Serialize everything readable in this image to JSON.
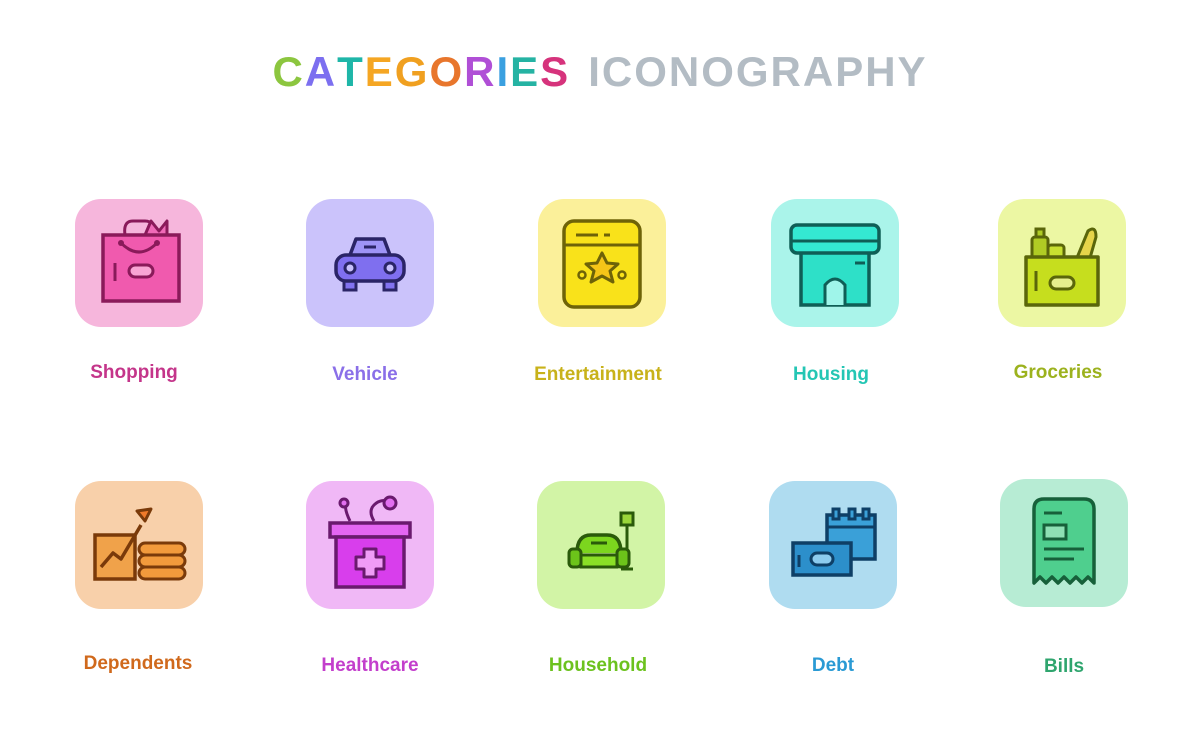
{
  "title": {
    "word1": [
      "C",
      "A",
      "T",
      "E",
      "G",
      "O",
      "R",
      "I",
      "E",
      "S"
    ],
    "word1_colors": [
      "#8cc63f",
      "#7c6ff0",
      "#1eb6a8",
      "#f5a623",
      "#f0a020",
      "#e8762c",
      "#b04fd6",
      "#3aa0e0",
      "#25b3a3",
      "#d6337c"
    ],
    "word2": "ICONOGRAPHY",
    "word2_color": "#b3bcc4"
  },
  "categories": [
    {
      "label": "Shopping",
      "icon": "shopping-bag-icon",
      "tile_color": "#f6b6dc",
      "label_color": "#c4358a"
    },
    {
      "label": "Vehicle",
      "icon": "car-icon",
      "tile_color": "#cbc3fb",
      "label_color": "#8a6fe8"
    },
    {
      "label": "Entertainment",
      "icon": "ticket-star-icon",
      "tile_color": "#fbf09a",
      "label_color": "#c8b21a"
    },
    {
      "label": "Housing",
      "icon": "house-icon",
      "tile_color": "#aaf4ea",
      "label_color": "#24c6b4"
    },
    {
      "label": "Groceries",
      "icon": "grocery-bag-icon",
      "tile_color": "#ecf7a3",
      "label_color": "#9cb21e"
    },
    {
      "label": "Dependents",
      "icon": "growth-coins-icon",
      "tile_color": "#f8d0aa",
      "label_color": "#d0691c"
    },
    {
      "label": "Healthcare",
      "icon": "medical-kit-icon",
      "tile_color": "#f0b8f6",
      "label_color": "#c33fcc"
    },
    {
      "label": "Household",
      "icon": "sofa-lamp-icon",
      "tile_color": "#d2f4a6",
      "label_color": "#6cc21e"
    },
    {
      "label": "Debt",
      "icon": "calendar-money-icon",
      "tile_color": "#afdcf0",
      "label_color": "#2a9ad4"
    },
    {
      "label": "Bills",
      "icon": "receipt-icon",
      "tile_color": "#b7ecd4",
      "label_color": "#2fa56e"
    }
  ]
}
